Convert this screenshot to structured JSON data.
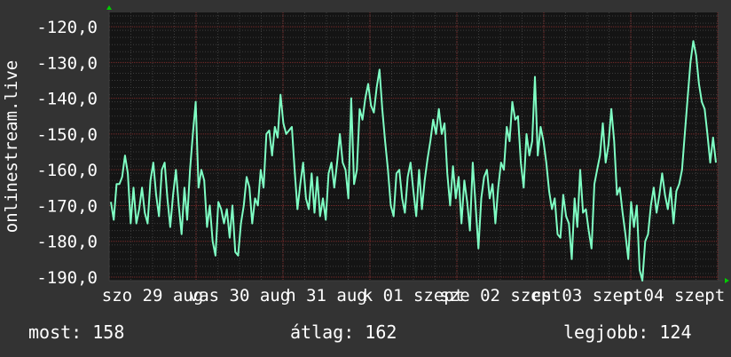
{
  "chart_data": {
    "type": "line",
    "ylabel": "onlinestream.live",
    "ylim": [
      -191,
      -116
    ],
    "grid": true,
    "y_ticks": [
      "-120,0",
      "-130,0",
      "-140,0",
      "-150,0",
      "-160,0",
      "-170,0",
      "-180,0",
      "-190,0"
    ],
    "y_tick_values": [
      -120,
      -130,
      -140,
      -150,
      -160,
      -170,
      -180,
      -190
    ],
    "x_ticks": [
      "szo 29 aug",
      "vas 30 aug",
      "h 31 aug",
      "k 01 szept",
      "sze 02 szept",
      "cs 03 szept",
      "p 04 szept"
    ],
    "x_range": [
      "2015-08-29",
      "2015-09-05"
    ],
    "series": [
      {
        "color": "#7fffc4",
        "values": [
          -169,
          -174,
          -164,
          -164,
          -162,
          -156,
          -161,
          -175,
          -165,
          -175,
          -171,
          -165,
          -172,
          -175,
          -163,
          -158,
          -167,
          -173,
          -160,
          -158,
          -168,
          -176,
          -167,
          -160,
          -170,
          -178,
          -165,
          -174,
          -160,
          -150,
          -141,
          -165,
          -160,
          -163,
          -176,
          -170,
          -180,
          -184,
          -169,
          -171,
          -175,
          -171,
          -179,
          -170,
          -183,
          -184,
          -175,
          -170,
          -162,
          -165,
          -175,
          -168,
          -170,
          -160,
          -165,
          -150,
          -149,
          -156,
          -148,
          -151,
          -139,
          -147,
          -150,
          -149,
          -148,
          -160,
          -171,
          -164,
          -158,
          -168,
          -171,
          -161,
          -172,
          -162,
          -173,
          -168,
          -174,
          -161,
          -158,
          -165,
          -158,
          -150,
          -158,
          -160,
          -168,
          -140,
          -164,
          -160,
          -143,
          -146,
          -140,
          -136,
          -142,
          -144,
          -137,
          -132,
          -143,
          -152,
          -160,
          -170,
          -173,
          -161,
          -160,
          -168,
          -172,
          -162,
          -158,
          -166,
          -173,
          -160,
          -171,
          -163,
          -157,
          -152,
          -146,
          -150,
          -143,
          -150,
          -147,
          -161,
          -170,
          -159,
          -168,
          -162,
          -175,
          -163,
          -169,
          -177,
          -158,
          -170,
          -182,
          -168,
          -162,
          -160,
          -168,
          -164,
          -175,
          -165,
          -158,
          -160,
          -148,
          -152,
          -141,
          -146,
          -145,
          -158,
          -165,
          -150,
          -156,
          -152,
          -134,
          -156,
          -148,
          -152,
          -158,
          -166,
          -171,
          -168,
          -178,
          -179,
          -167,
          -173,
          -175,
          -185,
          -168,
          -176,
          -160,
          -172,
          -171,
          -177,
          -182,
          -164,
          -160,
          -156,
          -147,
          -158,
          -153,
          -143,
          -152,
          -167,
          -165,
          -172,
          -178,
          -185,
          -169,
          -176,
          -170,
          -188,
          -191,
          -180,
          -178,
          -170,
          -165,
          -172,
          -167,
          -161,
          -167,
          -171,
          -165,
          -175,
          -166,
          -164,
          -160,
          -150,
          -140,
          -130,
          -124,
          -128,
          -136,
          -141,
          -143,
          -150,
          -158,
          -151,
          -158
        ]
      }
    ]
  },
  "stats": {
    "now": "most: 158",
    "avg": "átlag: 162",
    "best": "legjobb: 124"
  },
  "colors": {
    "background": "#333333",
    "plot_bg": "#141414",
    "line": "#7fffc4",
    "text": "#ffffff",
    "axis_arrow": "#00cc00",
    "major_grid": "#7a2a2a",
    "minor_grid": "#3c3c3c"
  }
}
